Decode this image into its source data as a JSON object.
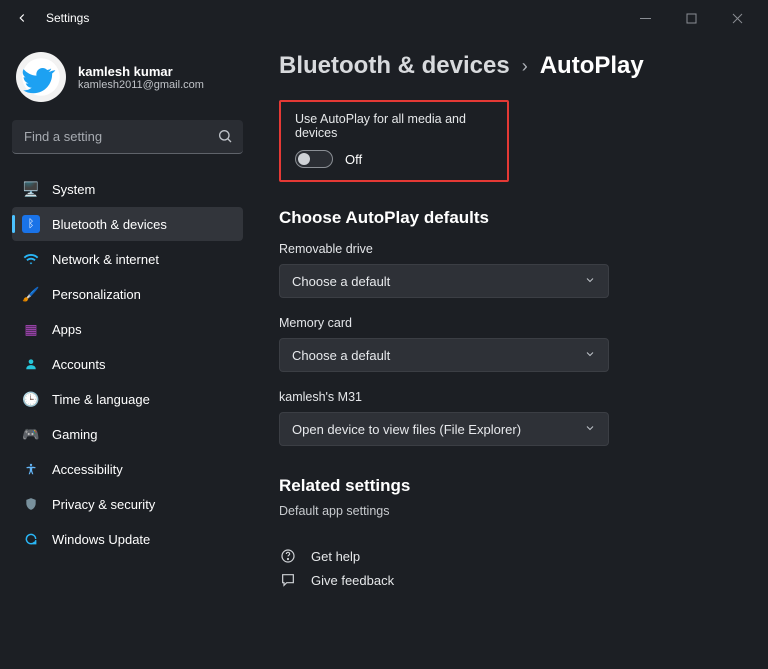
{
  "window": {
    "title": "Settings"
  },
  "profile": {
    "name": "kamlesh kumar",
    "email": "kamlesh2011@gmail.com"
  },
  "search": {
    "placeholder": "Find a setting"
  },
  "nav": {
    "system": "System",
    "bluetooth": "Bluetooth & devices",
    "network": "Network & internet",
    "personalization": "Personalization",
    "apps": "Apps",
    "accounts": "Accounts",
    "time": "Time & language",
    "gaming": "Gaming",
    "accessibility": "Accessibility",
    "privacy": "Privacy & security",
    "update": "Windows Update"
  },
  "breadcrumb": {
    "parent": "Bluetooth & devices",
    "current": "AutoPlay"
  },
  "autoplay_toggle": {
    "label": "Use AutoPlay for all media and devices",
    "state": "Off"
  },
  "defaults": {
    "heading": "Choose AutoPlay defaults",
    "removable": {
      "label": "Removable drive",
      "value": "Choose a default"
    },
    "memory": {
      "label": "Memory card",
      "value": "Choose a default"
    },
    "device": {
      "label": "kamlesh's M31",
      "value": "Open device to view files (File Explorer)"
    }
  },
  "related": {
    "heading": "Related settings",
    "default_apps": "Default app settings"
  },
  "links": {
    "help": "Get help",
    "feedback": "Give feedback"
  }
}
